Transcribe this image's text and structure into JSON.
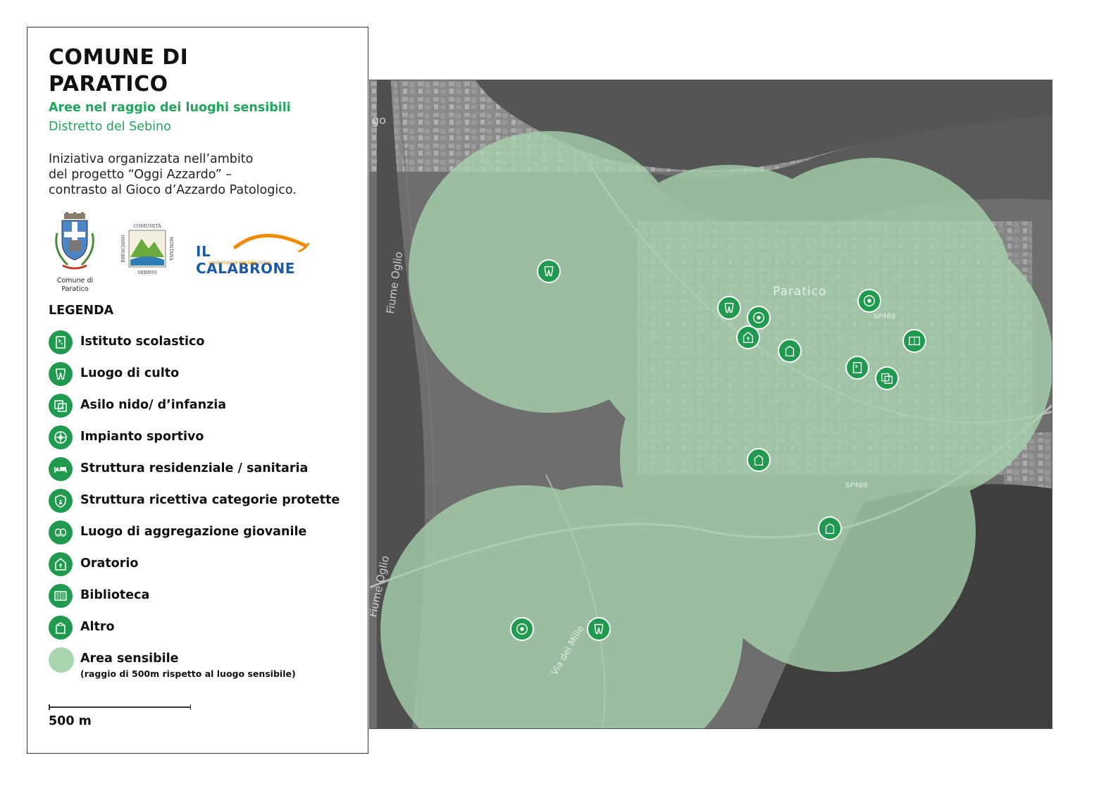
{
  "header": {
    "title_line1": "COMUNE DI",
    "title_line2": "PARATICO",
    "subtitle": "Aree nel raggio dei luoghi sensibili",
    "district": "Distretto del Sebino",
    "intro_line1": "Iniziativa organizzata nell’ambito",
    "intro_line2": "del progetto “Oggi Azzardo” –",
    "intro_line3": "contrasto al Gioco d’Azzardo Patologico."
  },
  "logos": {
    "comune_label_line1": "Comune di",
    "comune_label_line2": "Paratico",
    "comunita_top": "COMUNITÀ",
    "comunita_left": "BRESCIANO",
    "comunita_right": "MONTANA",
    "comunita_bottom": "SEBINO",
    "calabrone_name": "IL CALABRONE",
    "calabrone_sub": "cooperativa sociale onlus"
  },
  "legend": {
    "title": "LEGENDA",
    "items": [
      {
        "label": "Istituto scolastico",
        "icon": "school-icon"
      },
      {
        "label": "Luogo di culto",
        "icon": "worship-icon"
      },
      {
        "label": "Asilo nido/ d’infanzia",
        "icon": "nursery-icon"
      },
      {
        "label": "Impianto sportivo",
        "icon": "sports-icon"
      },
      {
        "label": "Struttura residenziale / sanitaria",
        "icon": "health-bed-icon"
      },
      {
        "label": "Struttura ricettiva categorie protette",
        "icon": "protected-shelter-icon"
      },
      {
        "label": "Luogo di aggregazione giovanile",
        "icon": "youth-masks-icon"
      },
      {
        "label": "Oratorio",
        "icon": "oratory-icon"
      },
      {
        "label": "Biblioteca",
        "icon": "library-icon"
      },
      {
        "label": "Altro",
        "icon": "other-icon"
      }
    ],
    "area_label": "Area sensibile",
    "area_note": "(raggio di 500m rispetto al luogo sensibile)"
  },
  "scale": {
    "label": "500 m"
  },
  "map": {
    "labels": {
      "town": "Paratico",
      "river1": "Fiume Oglio",
      "river2": "Fiume Oglio",
      "road1": "SP469",
      "road2": "SP469",
      "street": "Via dei Mille",
      "edge": "go"
    },
    "colors": {
      "area": "#a8d4ae",
      "marker": "#1f9a4e"
    }
  }
}
